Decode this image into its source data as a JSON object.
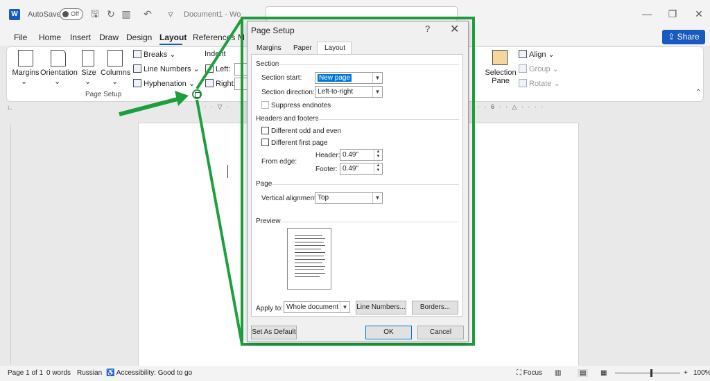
{
  "titlebar": {
    "app_logo": "W",
    "autosave_label": "AutoSave",
    "autosave_state": "Off",
    "doc_title": "Document1 - Wo"
  },
  "tabs": [
    "File",
    "Home",
    "Insert",
    "Draw",
    "Design",
    "Layout",
    "References",
    "M"
  ],
  "share_label": "Share",
  "ribbon": {
    "margins": "Margins",
    "orientation": "Orientation",
    "size": "Size",
    "columns": "Columns",
    "breaks": "Breaks",
    "line_numbers": "Line Numbers",
    "hyphenation": "Hyphenation",
    "group_label": "Page Setup",
    "indent": "Indent",
    "left": "Left:",
    "right": "Right:",
    "selection_pane": "Selection Pane",
    "align": "Align",
    "group": "Group",
    "rotate": "Rotate"
  },
  "dialog": {
    "title": "Page Setup",
    "help": "?",
    "close": "✕",
    "tabs": [
      "Margins",
      "Paper",
      "Layout"
    ],
    "active_tab": "Layout",
    "section": {
      "title": "Section",
      "start_label": "Section start:",
      "start_value": "New page",
      "direction_label": "Section direction:",
      "direction_value": "Left-to-right",
      "suppress_endnotes": "Suppress endnotes"
    },
    "headers_footers": {
      "title": "Headers and footers",
      "diff_odd_even": "Different odd and even",
      "diff_first_page": "Different first page",
      "from_edge": "From edge:",
      "header_label": "Header:",
      "header_value": "0.49\"",
      "footer_label": "Footer:",
      "footer_value": "0.49\""
    },
    "page": {
      "title": "Page",
      "vertical_alignment_label": "Vertical alignment:",
      "vertical_alignment_value": "Top"
    },
    "preview": {
      "title": "Preview"
    },
    "apply_to_label": "Apply to:",
    "apply_to_value": "Whole document",
    "line_numbers_btn": "Line Numbers...",
    "borders_btn": "Borders...",
    "set_default_btn": "Set As Default",
    "ok_btn": "OK",
    "cancel_btn": "Cancel"
  },
  "statusbar": {
    "page": "Page 1 of 1",
    "words": "0 words",
    "language": "Russian",
    "accessibility": "Accessibility: Good to go",
    "focus": "Focus",
    "zoom": "100%"
  },
  "colors": {
    "accent": "#185abd",
    "callout": "#1e9e3f",
    "selection": "#0078d7"
  }
}
